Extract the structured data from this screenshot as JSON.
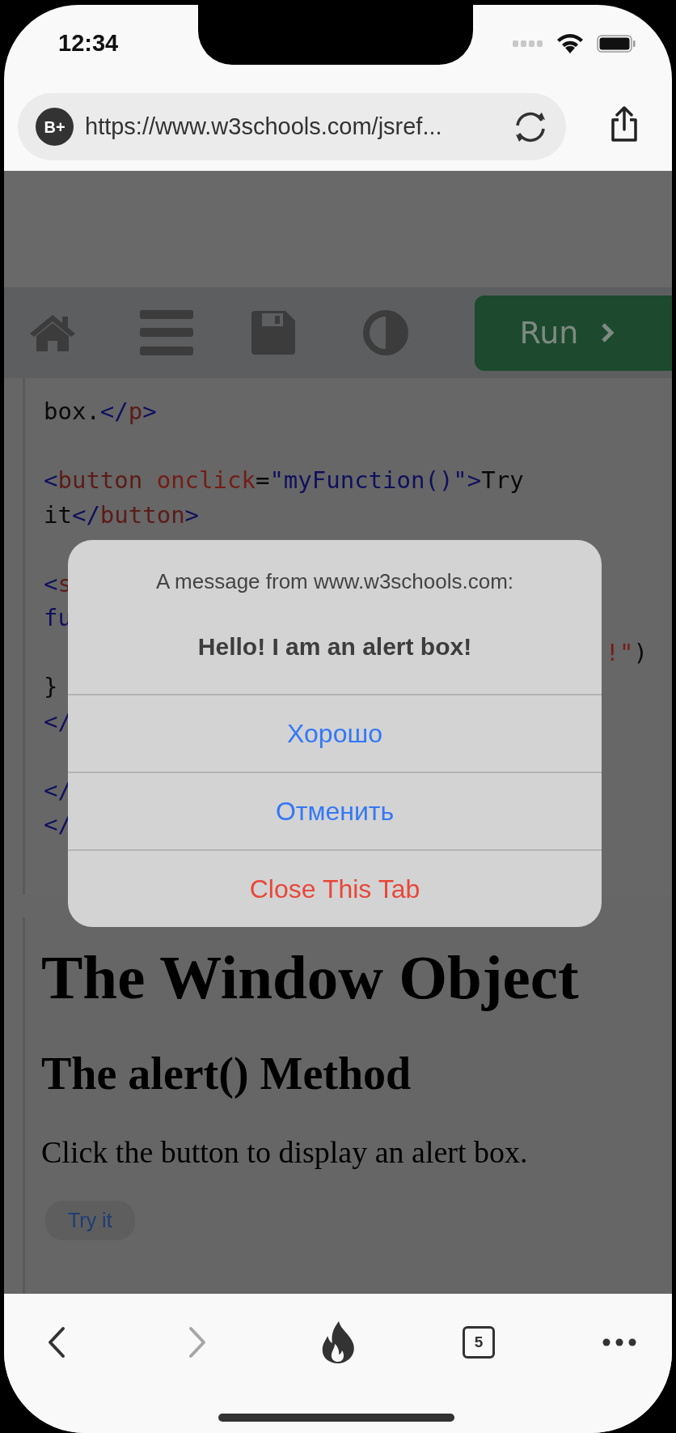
{
  "status_bar": {
    "time": "12:34"
  },
  "address_bar": {
    "badge": "B+",
    "url": "https://www.w3schools.com/jsref..."
  },
  "editor_toolbar": {
    "run_label": "Run"
  },
  "code_lines": [
    {
      "kind": "code",
      "tokens": [
        {
          "text": "box.",
          "kind": "text"
        },
        {
          "text": "</",
          "kind": "bracket"
        },
        {
          "text": "p",
          "kind": "tag"
        },
        {
          "text": ">",
          "kind": "bracket"
        }
      ]
    },
    {
      "kind": "blank"
    },
    {
      "kind": "code",
      "tokens": [
        {
          "text": "<",
          "kind": "bracket"
        },
        {
          "text": "button",
          "kind": "tag"
        },
        {
          "text": " onclick",
          "kind": "attr"
        },
        {
          "text": "=",
          "kind": "text"
        },
        {
          "text": "\"myFunction()\">",
          "kind": "value"
        },
        {
          "text": "Try",
          "kind": "text"
        }
      ]
    },
    {
      "kind": "code",
      "tokens": [
        {
          "text": "it",
          "kind": "text"
        },
        {
          "text": "</",
          "kind": "bracket"
        },
        {
          "text": "button",
          "kind": "tag"
        },
        {
          "text": ">",
          "kind": "bracket"
        }
      ]
    },
    {
      "kind": "blank"
    },
    {
      "kind": "code",
      "tokens": [
        {
          "text": "<",
          "kind": "bracket"
        },
        {
          "text": "s",
          "kind": "tag"
        }
      ]
    },
    {
      "kind": "code",
      "tokens": [
        {
          "text": "fu",
          "kind": "value"
        }
      ]
    },
    {
      "kind": "fragment",
      "tokens": [
        {
          "text": "!\"",
          "kind": "attr"
        },
        {
          "text": ")",
          "kind": "text"
        }
      ]
    },
    {
      "kind": "code",
      "tokens": [
        {
          "text": "}",
          "kind": "text"
        }
      ]
    },
    {
      "kind": "code",
      "tokens": [
        {
          "text": "</",
          "kind": "bracket"
        }
      ]
    },
    {
      "kind": "blank"
    },
    {
      "kind": "code",
      "tokens": [
        {
          "text": "</",
          "kind": "bracket"
        }
      ]
    },
    {
      "kind": "code",
      "tokens": [
        {
          "text": "</",
          "kind": "bracket"
        }
      ]
    }
  ],
  "result": {
    "heading": "The Window Object",
    "subheading": "The alert() Method",
    "paragraph": "Click the button to display an alert box.",
    "button": "Try it"
  },
  "alert": {
    "origin": "A message from www.w3schools.com:",
    "message": "Hello! I am an alert box!",
    "actions": [
      {
        "label": "Хорошо",
        "kind": "default"
      },
      {
        "label": "Отменить",
        "kind": "default"
      },
      {
        "label": "Close This Tab",
        "kind": "destructive"
      }
    ]
  },
  "bottom_bar": [
    {
      "kind": "back",
      "disabled": false
    },
    {
      "kind": "forward",
      "disabled": true
    },
    {
      "kind": "fire",
      "disabled": false
    },
    {
      "kind": "tabs",
      "count": "5",
      "disabled": false
    },
    {
      "kind": "more",
      "disabled": false
    }
  ]
}
